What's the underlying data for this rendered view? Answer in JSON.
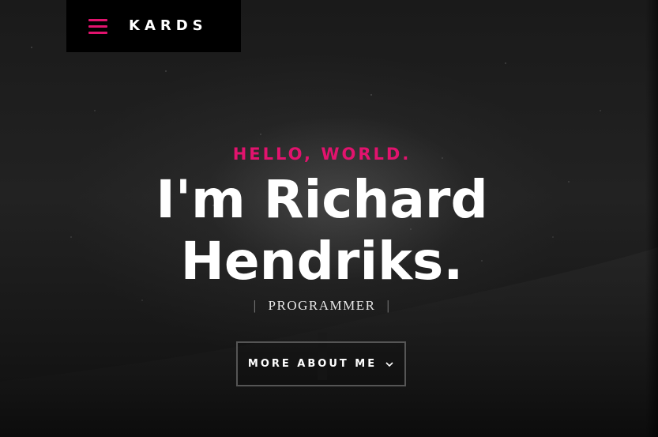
{
  "header": {
    "logo_text": "KARDS",
    "menu_icon": "hamburger-menu-icon",
    "accent_color": "#e2136e"
  },
  "hero": {
    "greeting": "HELLO, WORLD.",
    "name_line_1": "I'm Richard",
    "name_line_2": "Hendriks.",
    "role": "PROGRAMMER",
    "role_separator": "|",
    "cta_label": "MORE ABOUT ME",
    "cta_icon": "chevron-down-icon"
  }
}
